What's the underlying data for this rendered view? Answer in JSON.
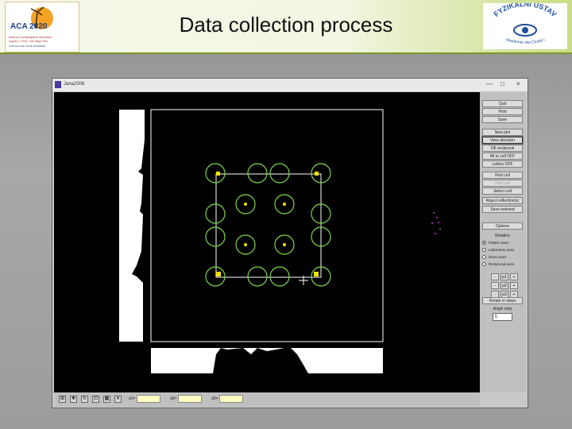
{
  "slide": {
    "title": "Data collection process"
  },
  "logo_left": {
    "text": "ACA 2020",
    "caption1": "American Crystallographic Association",
    "caption2": "August 2-7 2020 · San Diego 2020",
    "caption3": "VIRTUAL DUE COVID PANDEMIC"
  },
  "logo_right": {
    "text": "FYZIKÁLNÍ ÚSTAV",
    "caption": "Akademie věd České r."
  },
  "window": {
    "title": "Jana2006",
    "controls": [
      "—",
      "□",
      "×"
    ]
  },
  "panel": {
    "buttons": [
      {
        "label": "Quit",
        "state": "normal"
      },
      {
        "label": "Print",
        "state": "normal"
      },
      {
        "label": "Save",
        "state": "normal"
      },
      {
        "label": "New plot",
        "state": "normal"
      },
      {
        "label": "View direction",
        "state": "selected"
      },
      {
        "label": "Fill reciprocal",
        "state": "normal"
      },
      {
        "label": "All to cell OFF",
        "state": "normal"
      },
      {
        "label": "Lattice OFF",
        "state": "normal"
      },
      {
        "label": "Find cell",
        "state": "normal"
      },
      {
        "label": "Find cell",
        "state": "disabled"
      },
      {
        "label": "Select cell",
        "state": "normal"
      },
      {
        "label": "Reject reflection(s)",
        "state": "normal"
      },
      {
        "label": "Save indexed",
        "state": "normal"
      },
      {
        "label": "Options",
        "state": "normal"
      }
    ],
    "rotation_label": "Rotation",
    "rotation_options": [
      {
        "label": "Pattern axes",
        "selected": true
      },
      {
        "label": "Laboratory axes",
        "selected": false
      },
      {
        "label": "Direct axes",
        "selected": false
      },
      {
        "label": "Reciprocal axes",
        "selected": false
      }
    ],
    "axis_buttons": [
      [
        "p1",
        "+"
      ],
      [
        "p2",
        "+"
      ],
      [
        "p3",
        "+"
      ]
    ],
    "axis_minus": "-",
    "rotate_steps_label": "Rotate in steps",
    "angle_step_label": "Angle step",
    "angle_step_value": "5"
  },
  "bottom_bar": {
    "fields": [
      {
        "label": "d1="
      },
      {
        "label": "d2="
      },
      {
        "label": "d3="
      }
    ]
  },
  "colors": {
    "accent_green": "#7a9a2a",
    "circle_green": "#7fd64a",
    "spot_yellow": "#f2e600",
    "scatter_magenta": "#c040c0",
    "field_yellow": "#ffffc0"
  }
}
